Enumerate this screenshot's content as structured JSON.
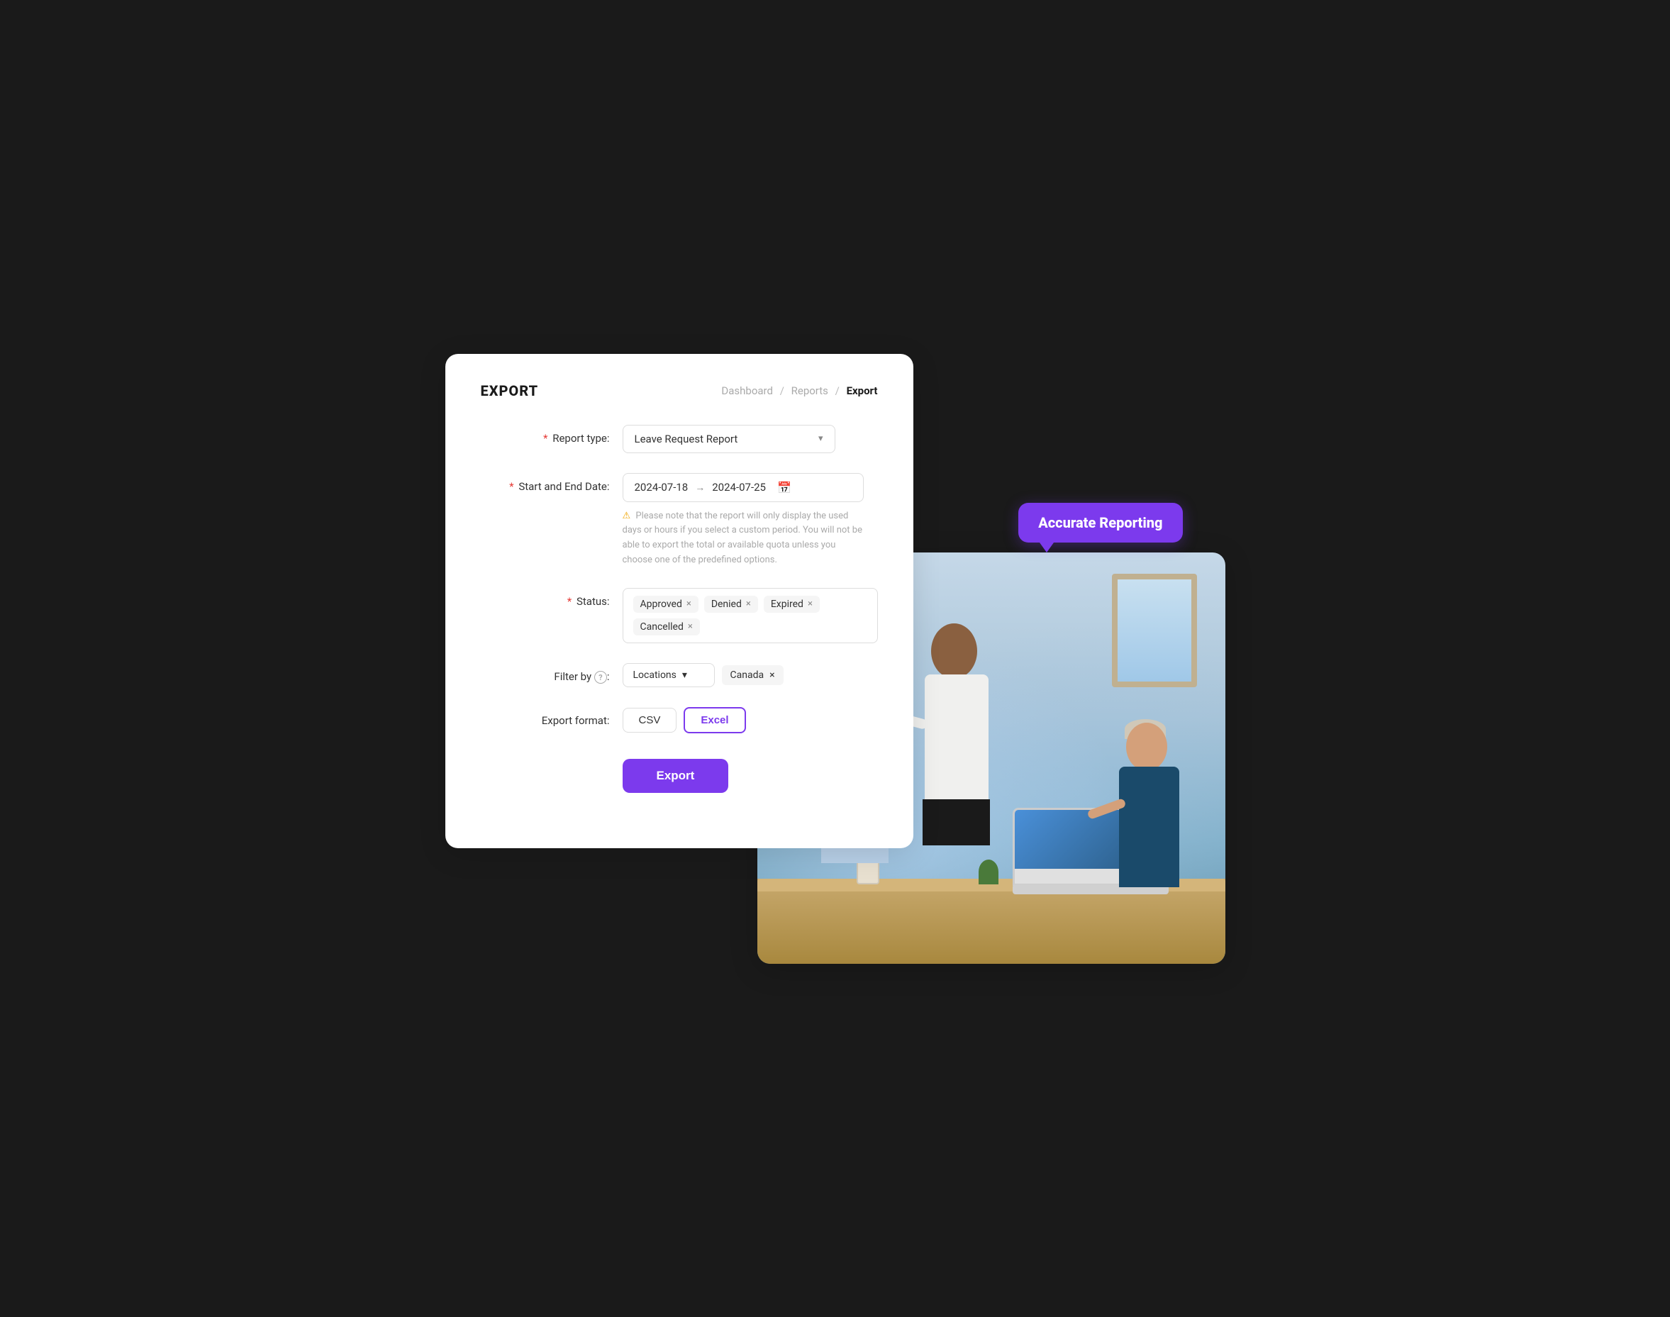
{
  "page": {
    "title": "EXPORT",
    "breadcrumb": {
      "items": [
        "Dashboard",
        "Reports",
        "Export"
      ],
      "active": "Export"
    }
  },
  "form": {
    "report_type": {
      "label": "Report type",
      "required": true,
      "value": "Leave Request Report"
    },
    "date_range": {
      "label": "Start and End Date",
      "required": true,
      "start": "2024-07-18",
      "end": "2024-07-25",
      "warning": "Please note that the report will only display the used days or hours if you select a custom period. You will not be able to export the total or available quota unless you choose one of the predefined options."
    },
    "status": {
      "label": "Status",
      "required": true,
      "tags": [
        "Approved",
        "Denied",
        "Expired",
        "Cancelled"
      ]
    },
    "filter_by": {
      "label": "Filter by",
      "has_help": true,
      "filter_type": "Locations",
      "filter_value": "Canada"
    },
    "export_format": {
      "label": "Export format",
      "options": [
        "CSV",
        "Excel"
      ],
      "selected": "Excel"
    },
    "export_button": "Export"
  },
  "promo": {
    "badge_text": "Accurate Reporting"
  },
  "icons": {
    "chevron_down": "▾",
    "calendar": "📅",
    "warning": "⚠",
    "question": "?",
    "close": "×",
    "arrow": "→"
  }
}
